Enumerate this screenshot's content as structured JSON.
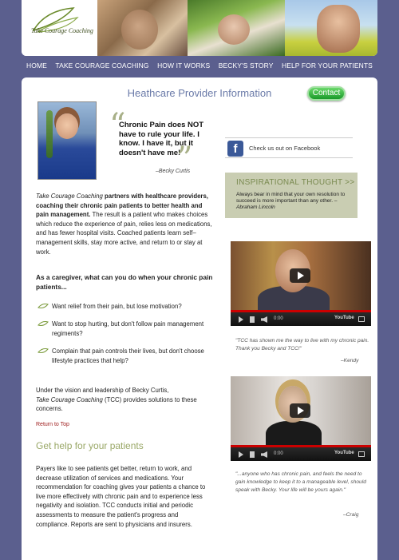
{
  "header": {
    "logo_text": "Take Courage Coaching"
  },
  "nav": {
    "items": [
      "HOME",
      "TAKE COURAGE COACHING",
      "HOW IT WORKS",
      "BECKY'S STORY",
      "HELP FOR YOUR PATIENTS"
    ]
  },
  "main": {
    "page_title": "Heathcare Provider Information",
    "contact_label": "Contact",
    "quote": {
      "text": "Chronic Pain does NOT have to rule your life. I know. I have it, but it doesn't have me!",
      "author": "–Becky Curtis"
    },
    "facebook": {
      "label": "Check us out on Facebook"
    },
    "inspirational": {
      "title": "INSPIRATIONAL THOUGHT >>",
      "text": "Always bear in mind that your own resolution to succeed is more important than any other. –",
      "author": "Abraham Lincoln"
    },
    "intro": {
      "brand": "Take Courage Coaching",
      "bold_part": " partners with healthcare providers, coaching their chronic pain patients to better health and pain management.",
      "rest": " The result is a patient who makes choices which reduce the experience of pain, relies less on medications, and has fewer hospital visits. Coached patients learn self–management skills, stay more active, and return to or stay at work."
    },
    "caregiver_heading": "As a caregiver, what can you do when your chronic pain patients...",
    "bullets": [
      "Want relief from their pain, but lose motivation?",
      "Want to stop hurting, but don't follow pain management regiments?",
      "Complain that pain controls their lives, but don't choose lifestyle practices that help?"
    ],
    "vision": {
      "line1": "Under the vision and leadership of Becky Curtis,",
      "brand": "Take Courage Coaching",
      "line2": " (TCC) provides solutions to these concerns."
    },
    "return_top": "Return to Top",
    "section_title": "Get help for your patients",
    "payers_text": "Payers like to see patients get better, return to work, and decrease utilization of services and medications. Your recommendation for coaching gives your patients a chance to live more effectively with chronic pain and to experience less negativity and isolation. TCC conducts initial and periodic assessments to measure the patient's progress and compliance. Reports are sent to physicians and insurers."
  },
  "videos": [
    {
      "time": "0:00",
      "brand": "YouTube"
    },
    {
      "time": "0:00",
      "brand": "YouTube"
    }
  ],
  "testimonials": [
    {
      "text": "\"TCC has shown me the way to live with my chronic pain. Thank you Becky and TCC!\"",
      "author": "–Kendy"
    },
    {
      "text": "\"...anyone who has chronic pain, and feels the need to gain knowledge to keep it to a manageable level, should speak with Becky. Your life will be yours again.\"",
      "author": "–Craig"
    }
  ]
}
